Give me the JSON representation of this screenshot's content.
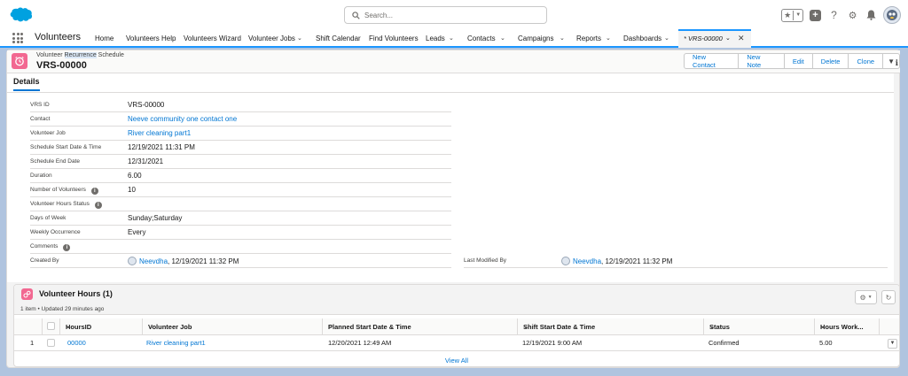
{
  "header": {
    "search_placeholder": "Search...",
    "icons": [
      "salesforce-logo",
      "favorites-star-icon",
      "favorites-dropdown-icon",
      "global-actions-plus-icon",
      "help-icon",
      "setup-gear-icon",
      "notifications-bell-icon",
      "user-avatar"
    ]
  },
  "nav": {
    "app_name": "Volunteers",
    "items": [
      {
        "label": "Home",
        "dropdown": false
      },
      {
        "label": "Volunteers Help",
        "dropdown": false
      },
      {
        "label": "Volunteers Wizard",
        "dropdown": false
      },
      {
        "label": "Volunteer Jobs",
        "dropdown": true
      },
      {
        "label": "Shift Calendar",
        "dropdown": false
      },
      {
        "label": "Find Volunteers",
        "dropdown": false
      },
      {
        "label": "Leads",
        "dropdown": true
      },
      {
        "label": "Contacts",
        "dropdown": true
      },
      {
        "label": "Campaigns",
        "dropdown": true
      },
      {
        "label": "Reports",
        "dropdown": true
      },
      {
        "label": "Dashboards",
        "dropdown": true
      }
    ],
    "active_tab": "* VRS-00000"
  },
  "record": {
    "object_type_pre": "Volunteer ",
    "object_type_highlight": "Recurrence",
    "object_type_post": " Schedule",
    "name": "VRS-00000",
    "actions": [
      "New Contact",
      "New Note",
      "Edit",
      "Delete",
      "Clone"
    ],
    "tab_label": "Details",
    "accent_color": "#f26891",
    "fields": {
      "vrs_id": {
        "label": "VRS ID",
        "value": "VRS-00000"
      },
      "contact": {
        "label": "Contact",
        "value": "Neeve community one contact one"
      },
      "volunteer_job": {
        "label": "Volunteer Job",
        "value": "River cleaning part1"
      },
      "start": {
        "label": "Schedule Start Date & Time",
        "value": "12/19/2021 11:31 PM"
      },
      "end": {
        "label": "Schedule End Date",
        "value": "12/31/2021"
      },
      "duration": {
        "label": "Duration",
        "value": "6.00"
      },
      "num_volunteers": {
        "label": "Number of Volunteers",
        "value": "10"
      },
      "hours_status": {
        "label": "Volunteer Hours Status",
        "value": ""
      },
      "days_of_week": {
        "label": "Days of Week",
        "value": "Sunday;Saturday"
      },
      "weekly_occurrence": {
        "label": "Weekly Occurrence",
        "value": "Every"
      },
      "comments": {
        "label": "Comments",
        "value": ""
      },
      "created_by": {
        "label": "Created By",
        "user": "Neevdha",
        "date": ", 12/19/2021 11:32 PM"
      },
      "last_modified_by": {
        "label": "Last Modified By",
        "user": "Neevdha",
        "date": ", 12/19/2021 11:32 PM"
      }
    }
  },
  "related": {
    "title": "Volunteer Hours (1)",
    "meta": "1 item • Updated 29 minutes ago",
    "columns": [
      "HoursID",
      "Volunteer Job",
      "Planned Start Date & Time",
      "Shift Start Date & Time",
      "Status",
      "Hours Work..."
    ],
    "rows": [
      {
        "num": "1",
        "hours_id": "00000",
        "job": "River cleaning part1",
        "planned": "12/20/2021 12:49 AM",
        "shift": "12/19/2021 9:00 AM",
        "status": "Confirmed",
        "hours": "5.00"
      }
    ],
    "view_all": "View All"
  }
}
